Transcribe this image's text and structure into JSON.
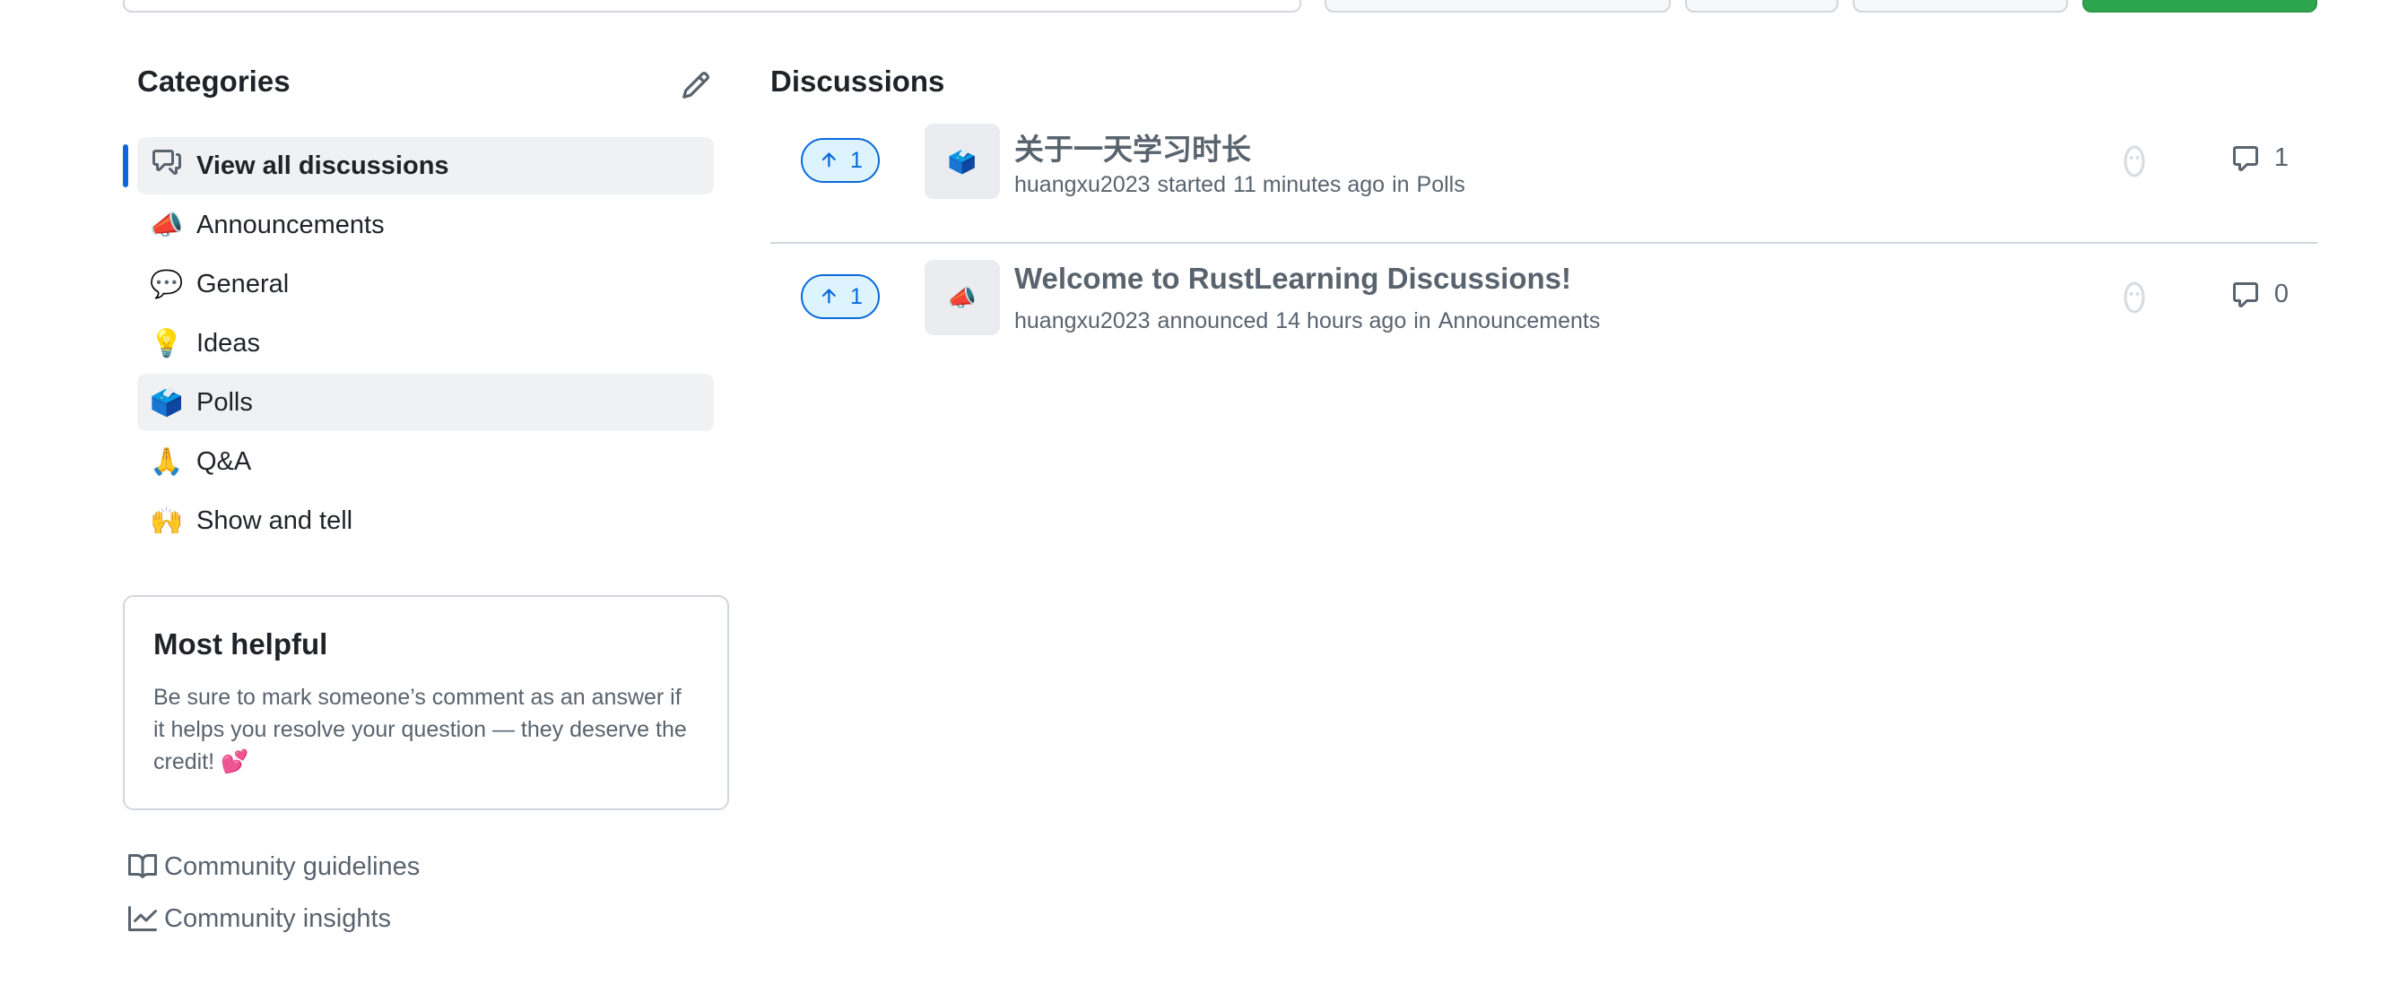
{
  "sidebar": {
    "title": "Categories",
    "categories": [
      {
        "emoji": "",
        "label": "View all discussions"
      },
      {
        "emoji": "📣",
        "label": "Announcements"
      },
      {
        "emoji": "💬",
        "label": "General"
      },
      {
        "emoji": "💡",
        "label": "Ideas"
      },
      {
        "emoji": "🗳️",
        "label": "Polls"
      },
      {
        "emoji": "🙏",
        "label": "Q&A"
      },
      {
        "emoji": "🙌",
        "label": "Show and tell"
      }
    ],
    "most_helpful": {
      "title": "Most helpful",
      "text": "Be sure to mark someone’s comment as an answer if it helps you resolve your question — they deserve the credit! 💕"
    },
    "links": [
      {
        "icon": "guidelines-icon",
        "label": "Community guidelines"
      },
      {
        "icon": "graph-icon",
        "label": "Community insights"
      }
    ]
  },
  "main": {
    "title": "Discussions",
    "discussions": [
      {
        "votes": "1",
        "category_emoji": "🗳️",
        "title": "关于一天学习时长",
        "author": "huangxu2023",
        "action": "started",
        "time": "11 minutes ago",
        "in": "in",
        "category": "Polls",
        "comments": "1"
      },
      {
        "votes": "1",
        "category_emoji": "📣",
        "title": "Welcome to RustLearning Discussions!",
        "author": "huangxu2023",
        "action": "announced",
        "time": "14 hours ago",
        "in": "in",
        "category": "Announcements",
        "comments": "0"
      }
    ]
  },
  "colors": {
    "accent": "#0969da",
    "vote_bg": "#ddf4ff",
    "primary_button": "#2da44e",
    "muted_text": "#59636e",
    "border": "#d0d7de"
  }
}
